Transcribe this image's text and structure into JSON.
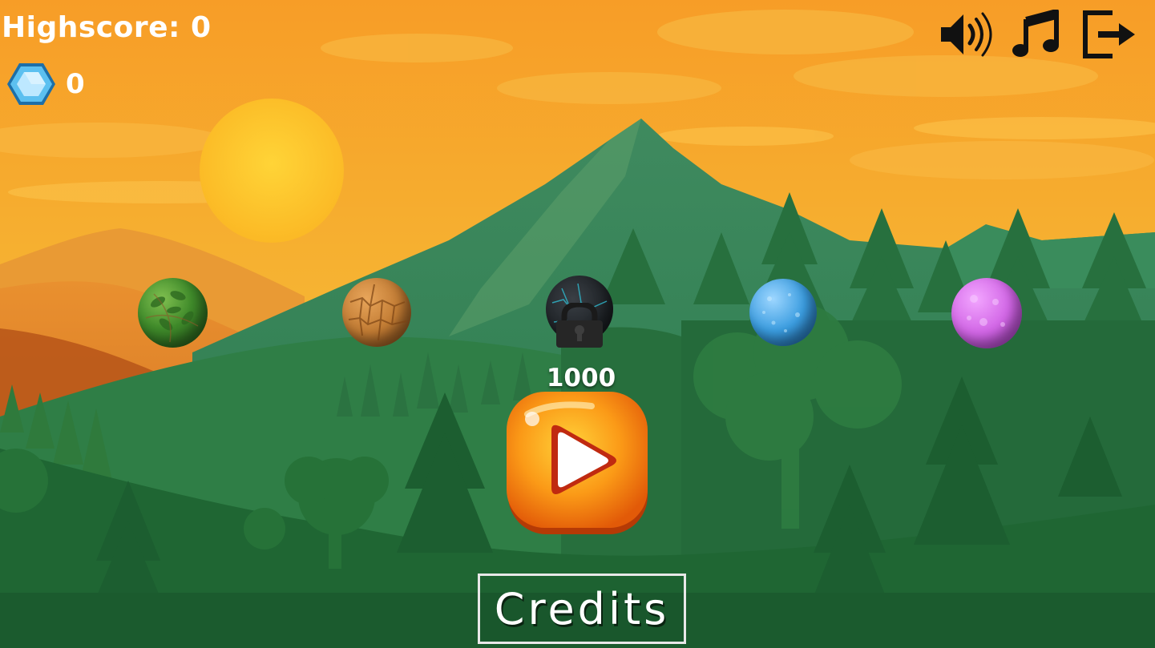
{
  "hud": {
    "highscore_text": "Highscore: 0",
    "gems_count": "0",
    "gem_icon": "hexagon-gem-icon"
  },
  "topbar": {
    "sound_icon": "speaker-icon",
    "music_icon": "music-note-icon",
    "exit_icon": "exit-door-icon"
  },
  "balls": [
    {
      "name": "leaf-ball",
      "locked": false
    },
    {
      "name": "rock-ball",
      "locked": false
    },
    {
      "name": "dark-ball",
      "locked": true,
      "price": "1000"
    },
    {
      "name": "ice-ball",
      "locked": false
    },
    {
      "name": "magic-ball",
      "locked": false
    }
  ],
  "locked_price": "1000",
  "play_icon": "play-icon",
  "credits_label": "Credits",
  "colors": {
    "sky_top": "#f7a22a",
    "sky_bottom": "#f5c04a",
    "sun": "#fdc22a",
    "forest": "#1f6b36",
    "play_button": "#f58a10",
    "gem": "#4fb3ea"
  }
}
